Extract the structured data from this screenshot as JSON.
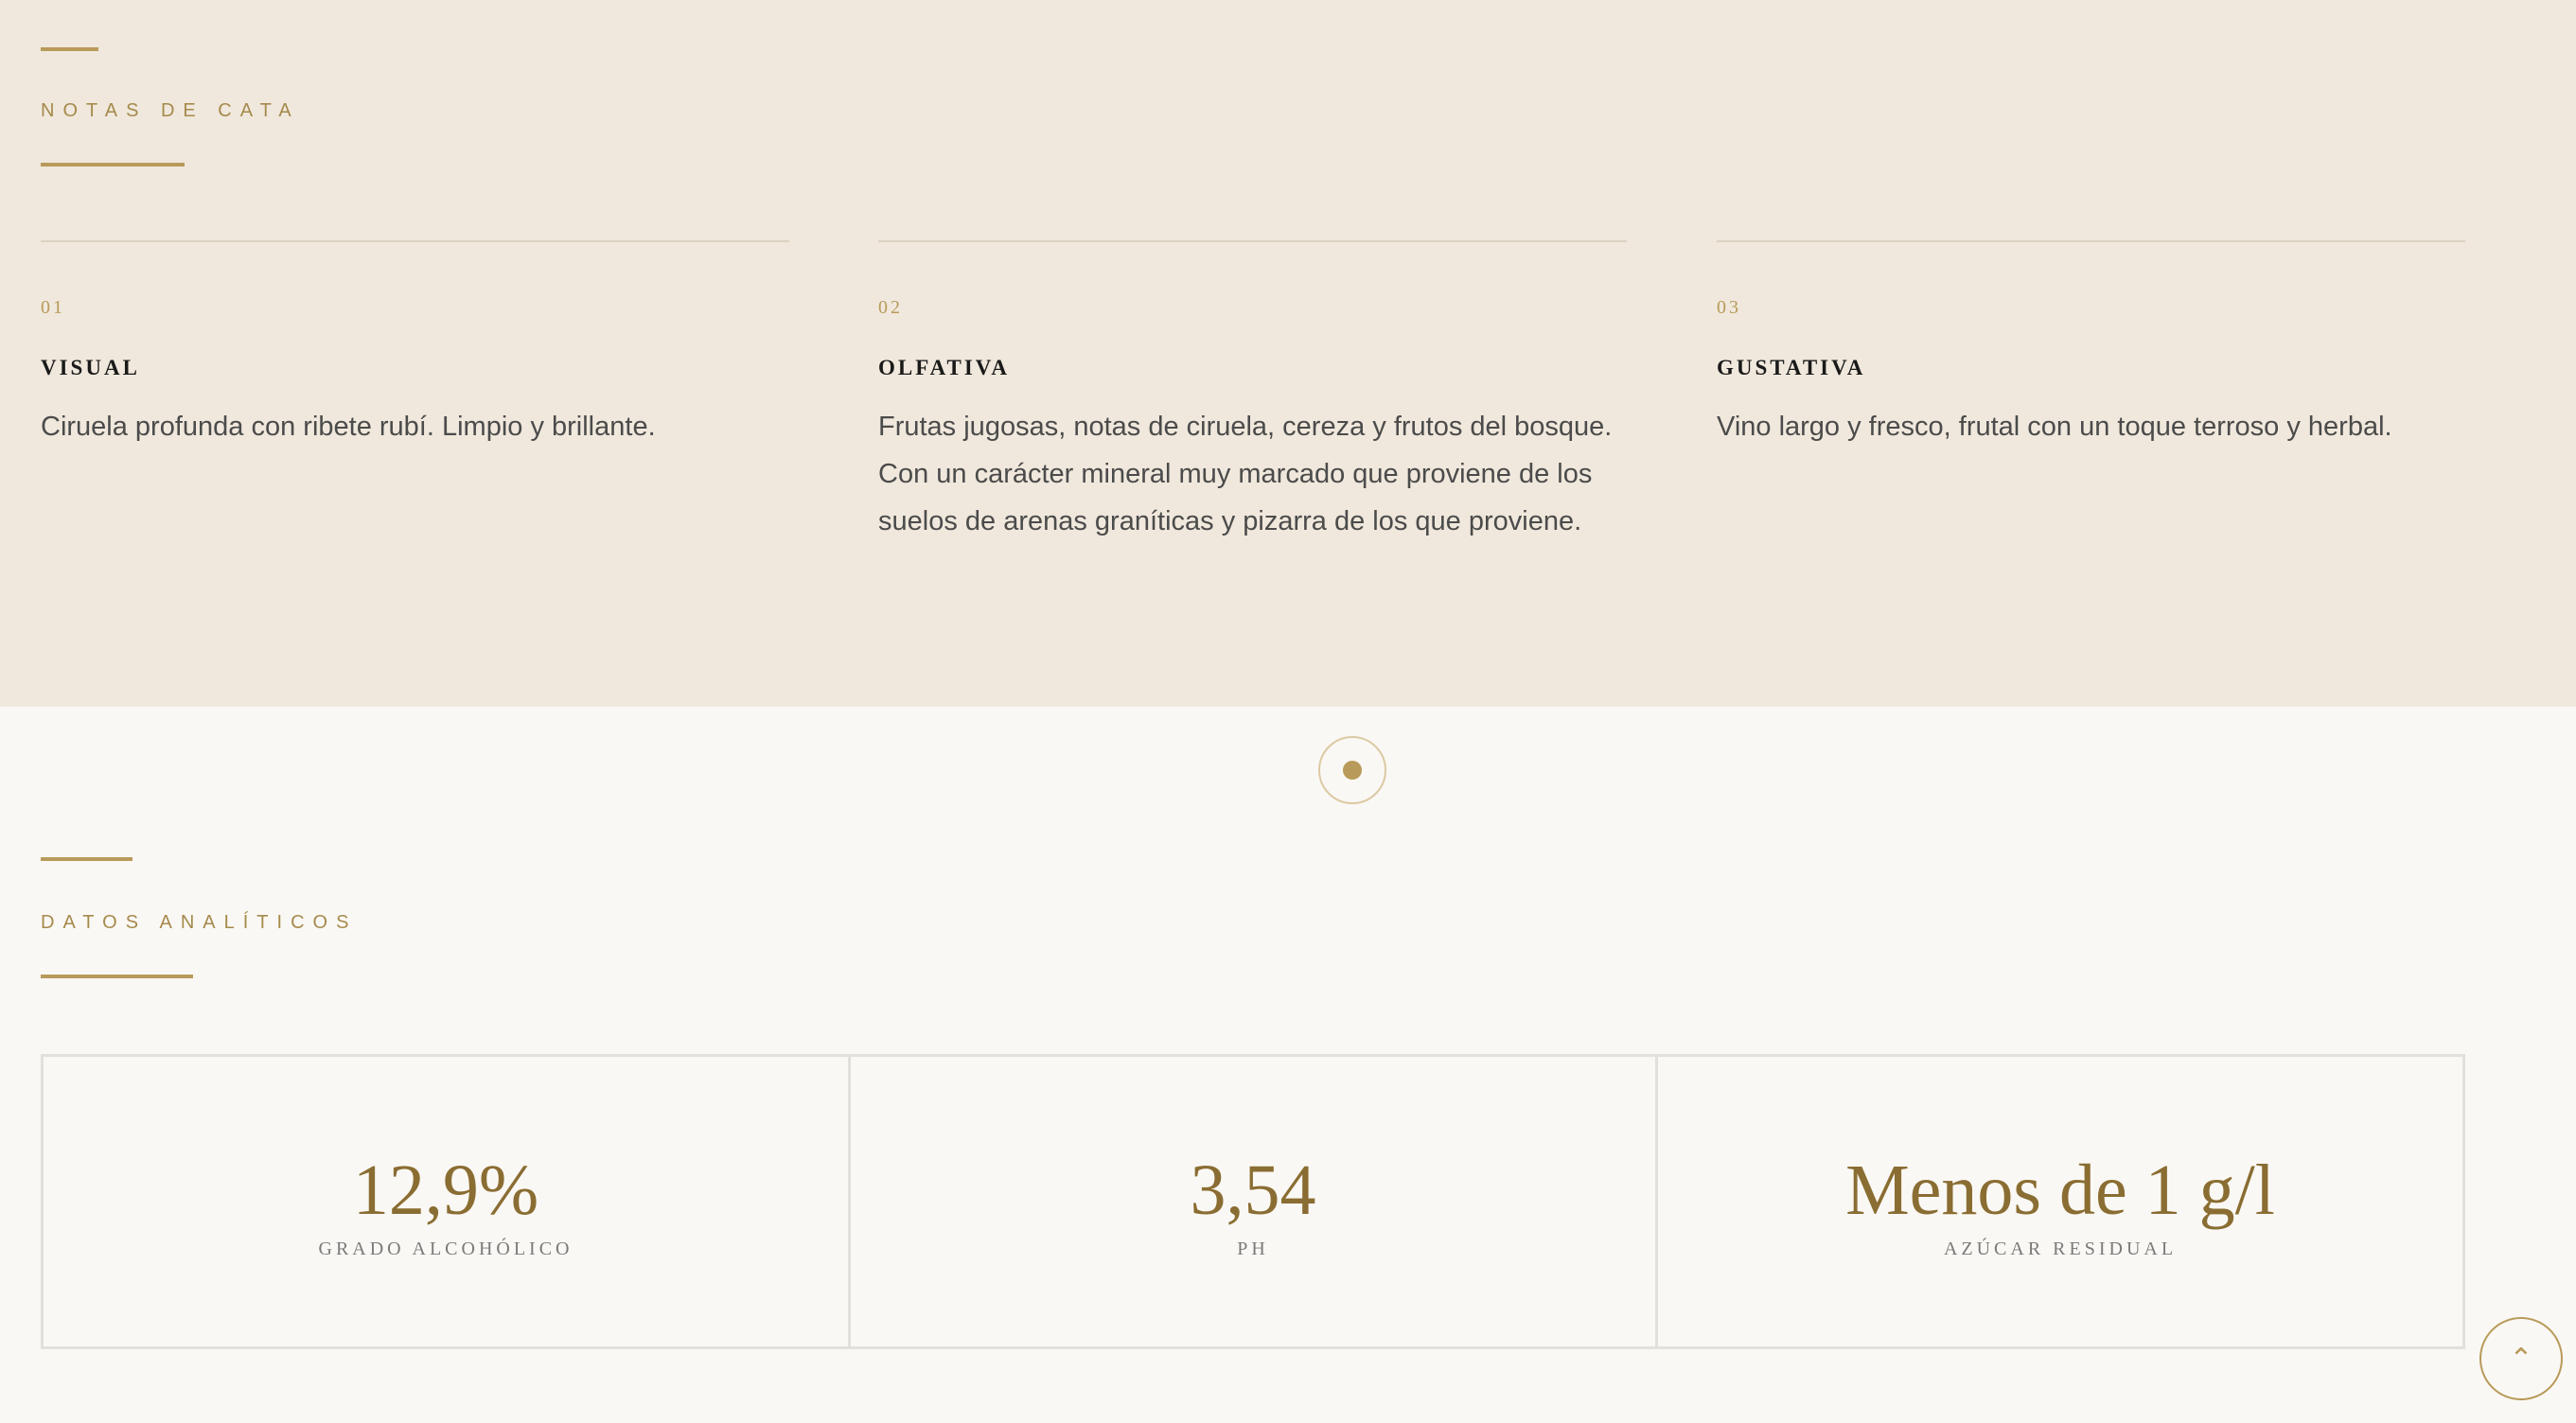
{
  "tasting": {
    "kicker": "NOTAS DE CATA",
    "columns": [
      {
        "num": "01",
        "title": "VISUAL",
        "text": "Ciruela profunda con ribete rubí. Limpio y brillante."
      },
      {
        "num": "02",
        "title": "OLFATIVA",
        "text": "Frutas jugosas, notas de ciruela, cereza y frutos del bosque. Con un carácter mineral muy marcado que proviene de los suelos de arenas graníticas y pizarra de los que proviene."
      },
      {
        "num": "03",
        "title": "GUSTATIVA",
        "text": "Vino largo y fresco, frutal con un toque terroso y herbal."
      }
    ]
  },
  "analytics": {
    "kicker": "DATOS ANALÍTICOS",
    "stats": [
      {
        "value": "12,9%",
        "label": "GRADO ALCOHÓLICO"
      },
      {
        "value": "3,54",
        "label": "PH"
      },
      {
        "value": "Menos de 1 g/l",
        "label": "AZÚCAR RESIDUAL"
      }
    ]
  },
  "scroll_top": {
    "icon": "chevron-up-icon",
    "glyph": "⌃"
  },
  "colors": {
    "accent": "#b89a5a",
    "value": "#8a6d32",
    "tasting_bg": "#f0e8dc",
    "page_bg": "#faf8f4"
  }
}
